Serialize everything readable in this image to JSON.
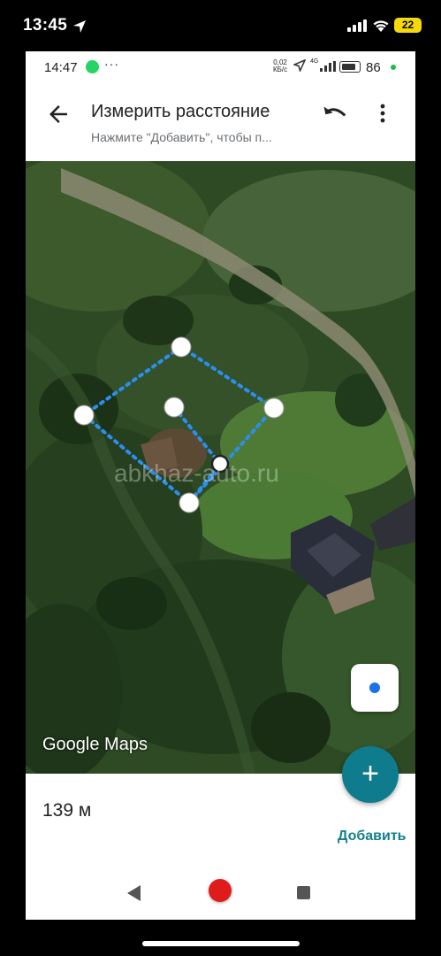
{
  "ios_status": {
    "time": "13:45",
    "battery": "22",
    "icons": [
      "location-arrow-icon",
      "cellular-signal-icon",
      "wifi-icon",
      "battery-icon"
    ]
  },
  "android_status": {
    "time": "14:47",
    "dots": "···",
    "net_speed_value": "0,02",
    "net_speed_unit": "КБ/c",
    "network_label": "4G",
    "battery_pct": "86",
    "icons": [
      "whatsapp-icon",
      "navigation-icon",
      "signal-bars-icon",
      "battery-icon"
    ]
  },
  "app_bar": {
    "title": "Измерить расстояние",
    "subtitle": "Нажмите \"Добавить\", чтобы п...",
    "icons": [
      "arrow-back-icon",
      "undo-icon",
      "more-vert-icon"
    ]
  },
  "map": {
    "watermark": "abkhaz-auto.ru",
    "logo": "Google Maps",
    "measurement_points_count": 6,
    "icons": [
      "my-location-icon"
    ]
  },
  "fab": {
    "label": "+"
  },
  "bottom": {
    "distance": "139 м",
    "add_label": "Добавить"
  },
  "nav_bar": {
    "icons": [
      "nav-back-icon",
      "nav-home-icon",
      "nav-recents-icon"
    ]
  },
  "colors": {
    "accent": "#0f7c8e",
    "measure_line": "#2b8ff0",
    "home_button": "#e01b1b",
    "ios_battery": "#f5d90a"
  }
}
